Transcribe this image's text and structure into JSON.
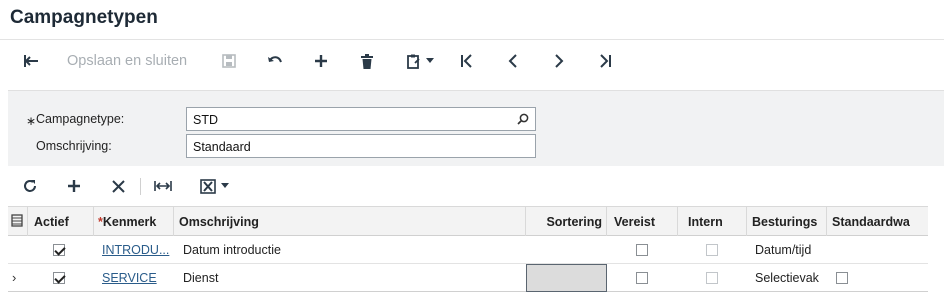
{
  "window": {
    "title": "Campagnetypen"
  },
  "toolbar": {
    "save_close_label": "Opslaan en sluiten"
  },
  "form": {
    "type_label": "Campagnetype:",
    "type_value": "STD",
    "description_label": "Omschrijving:",
    "description_value": "Standaard"
  },
  "grid": {
    "columns": {
      "actief": "Actief",
      "kenmerk": "Kenmerk",
      "omschrijving": "Omschrijving",
      "sortering": "Sortering",
      "vereist": "Vereist",
      "intern": "Intern",
      "besturing": "Besturings",
      "standaard": "Standaardwa"
    },
    "rows": [
      {
        "actief": true,
        "kenmerk": "INTRODU...",
        "omschrijving": "Datum introductie",
        "sortering": "",
        "vereist": false,
        "intern": false,
        "besturing": "Datum/tijd",
        "standaard": ""
      },
      {
        "actief": true,
        "kenmerk": "SERVICE",
        "omschrijving": "Dienst",
        "sortering": "",
        "vereist": false,
        "intern": false,
        "besturing": "Selectievak",
        "standaard": false
      }
    ]
  },
  "colors": {
    "accent": "#2a5c8a",
    "required": "#c0392b",
    "panel": "#f1f2f3"
  }
}
